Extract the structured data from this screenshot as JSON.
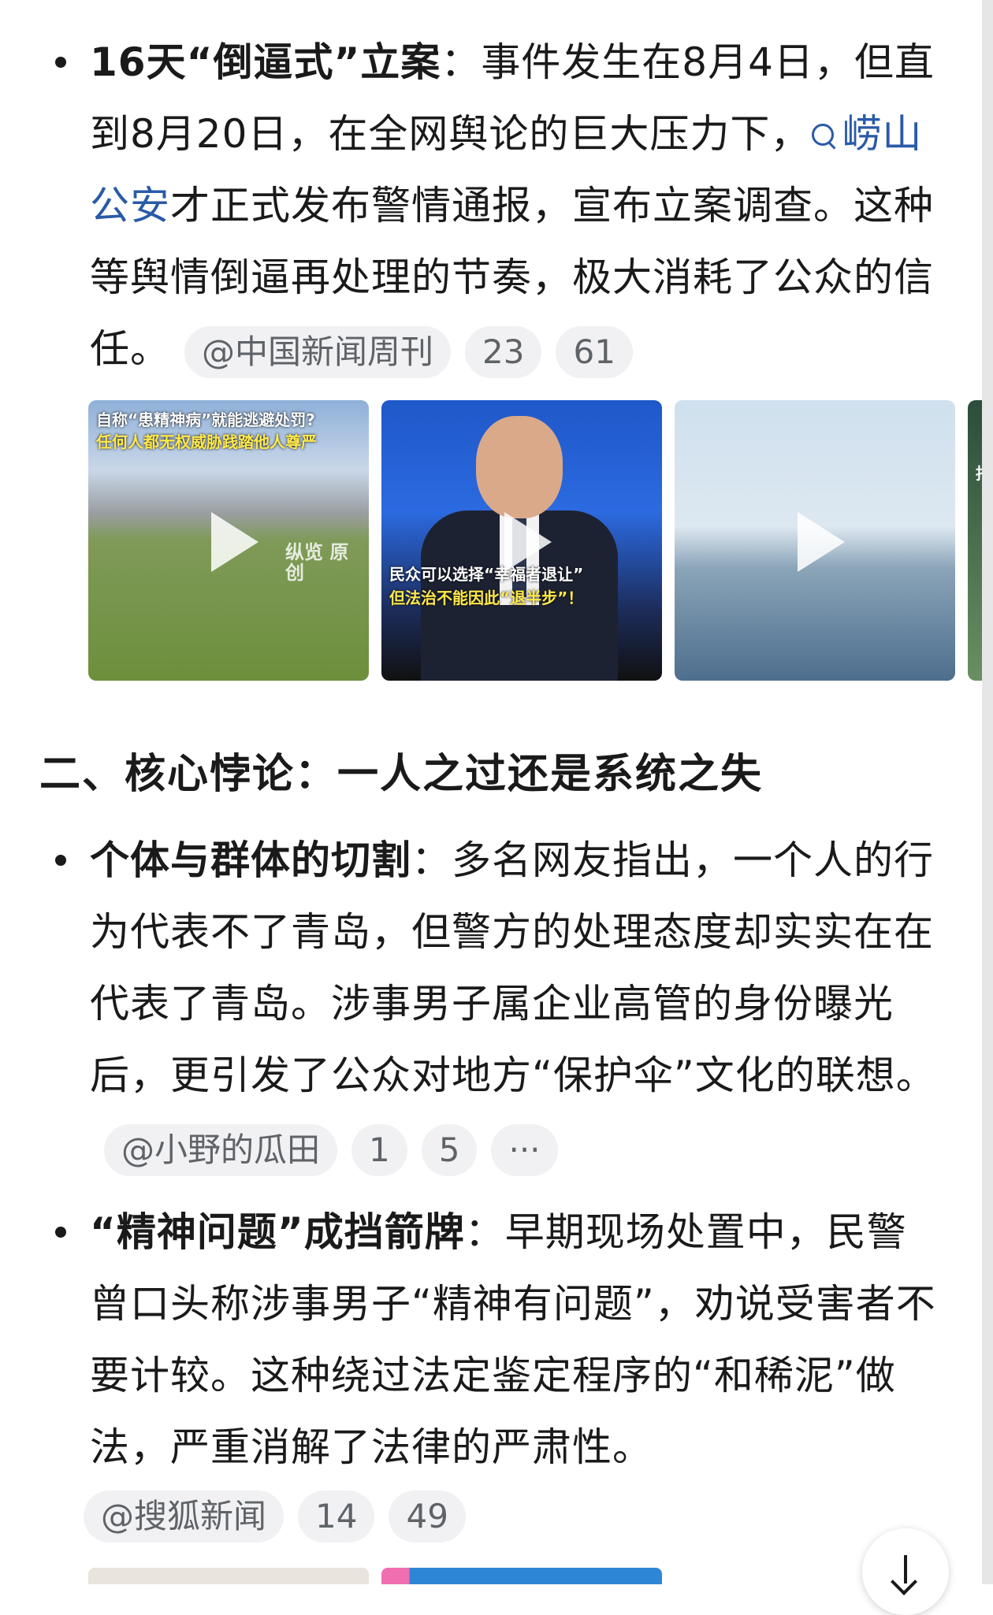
{
  "item1": {
    "bold": "16天“倒逼式”立案",
    "colon": "：",
    "text_a": "事件发生在8月4日，但直到8月20日，在全网舆论的巨大压力下，",
    "link": "崂山公安",
    "text_b": "才正式发布警情通报，宣布立案调查。这种等舆情倒逼再处理的节奏，极大消耗了公众的信任。",
    "source": "@中国新闻周刊",
    "count1": "23",
    "count2": "61"
  },
  "videos": [
    {
      "caption_top": "自称“患精神病”就能逃避处罚?",
      "caption_mid": "任何人都无权威胁践踏他人尊严",
      "watermark": "纵览 原创"
    },
    {
      "caption_1": "民众可以选择“幸福者退让”",
      "caption_2": "但法治不能因此“退半步”！"
    },
    {},
    {
      "caption": "指"
    }
  ],
  "section2": {
    "heading": "二、核心悖论：一人之过还是系统之失"
  },
  "item2": {
    "bold": "个体与群体的切割",
    "colon": "：",
    "text": "多名网友指出，一个人的行为代表不了青岛，但警方的处理态度却实实在在代表了青岛。涉事男子属企业高管的身份曝光后，更引发了公众对地方“保护伞”文化的联想。",
    "source": "@小野的瓜田",
    "count1": "1",
    "count2": "5",
    "more": "···"
  },
  "item3": {
    "bold": "“精神问题”成挡箭牌",
    "colon": "：",
    "text": "早期现场处置中，民警曾口头称涉事男子“精神有问题”，劝说受害者不要计较。这种绕过法定鉴定程序的“和稀泥”做法，严重消解了法律的严肃性。",
    "source": "@搜狐新闻",
    "count1": "14",
    "count2": "49"
  }
}
